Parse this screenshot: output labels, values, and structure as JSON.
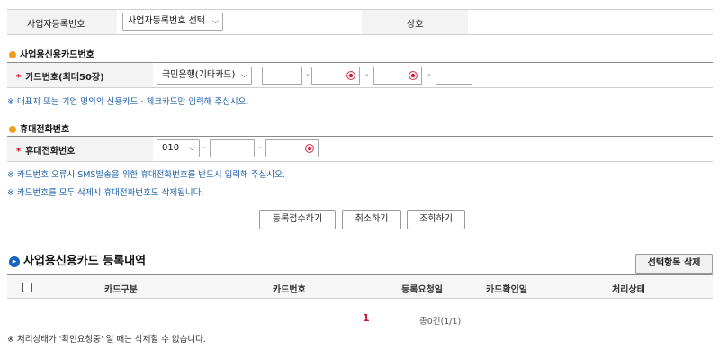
{
  "biz": {
    "label": "사업자등록번호",
    "select_value": "사업자등록번호 선택",
    "name_label": "상호"
  },
  "card_section": {
    "title": "사업용신용카드번호",
    "label": "카드번호(최대50장)",
    "bank_value": "국민은행(기타카드)",
    "note": "※ 대표자 또는 기업 명의의 신용카드 · 체크카드만 입력해 주십시오."
  },
  "phone_section": {
    "title": "휴대전화번호",
    "label": "휴대전화번호",
    "prefix_value": "010",
    "note1": "※ 카드번호 오류시 SMS발송을 위한 휴대전화번호를 반드시 입력해 주십시오.",
    "note2": "※ 카드번호를 모두 삭제시 휴대전화번호도 삭제됩니다."
  },
  "separator": "-",
  "actions": {
    "register": "등록접수하기",
    "cancel": "취소하기",
    "search": "조회하기"
  },
  "list": {
    "title": "사업용신용카드 등록내역",
    "delete_selected": "선택항목 삭제",
    "columns": [
      "카드구분",
      "카드번호",
      "등록요청일",
      "카드확인일",
      "처리상태"
    ],
    "page": "1",
    "total": "총0건(1/1)",
    "note": "※ 처리상태가 '확인요청중' 일 때는 삭제할 수 없습니다."
  },
  "colors": {
    "accent_red": "#c2183a",
    "note_blue": "#1e5fa8",
    "bullet_orange": "#f0a020",
    "section_icon_blue": "#1565c0"
  },
  "icons": [
    "chevron-down-icon",
    "secure-keypad-icon",
    "section-bullet-icon",
    "arrow-circle-icon",
    "checkbox"
  ]
}
